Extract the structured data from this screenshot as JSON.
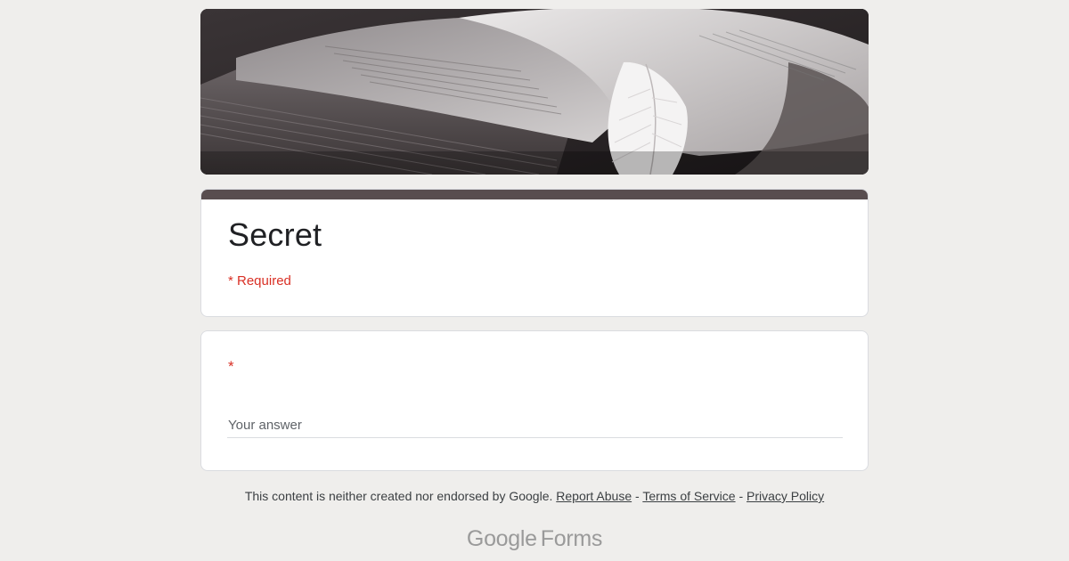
{
  "form": {
    "title": "Secret",
    "required_note": "* Required",
    "theme_color": "#584d4f"
  },
  "question": {
    "required_marker": "*",
    "answer_placeholder": "Your answer"
  },
  "footer": {
    "disclaimer": "This content is neither created nor endorsed by Google.",
    "separator": " - ",
    "report_abuse": "Report Abuse",
    "terms": "Terms of Service",
    "privacy": "Privacy Policy"
  },
  "brand": {
    "google": "Google",
    "forms": "Forms"
  },
  "header": {
    "image_icon": "open-book-with-feather-image"
  }
}
